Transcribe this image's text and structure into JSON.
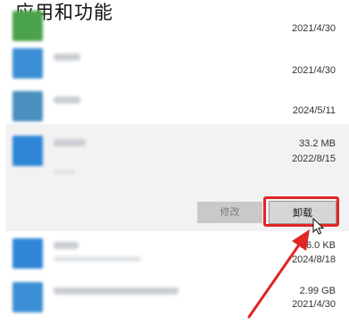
{
  "page": {
    "title": "应用和功能"
  },
  "apps": [
    {
      "date": "2021/4/30"
    },
    {
      "date": "2021/4/30"
    },
    {
      "date": "2024/5/11"
    },
    {
      "size": "33.2 MB",
      "date": "2022/8/15",
      "selected": true
    },
    {
      "size": "16.0 KB",
      "date": "2024/8/18"
    },
    {
      "size": "2.99 GB",
      "date": "2021/4/30"
    }
  ],
  "actions": {
    "modify_label": "修改",
    "uninstall_label": "卸载"
  },
  "colors": {
    "highlight": "#e02525",
    "selected_bg": "#f2f2f2",
    "icon_blue": "#3b87d6"
  }
}
